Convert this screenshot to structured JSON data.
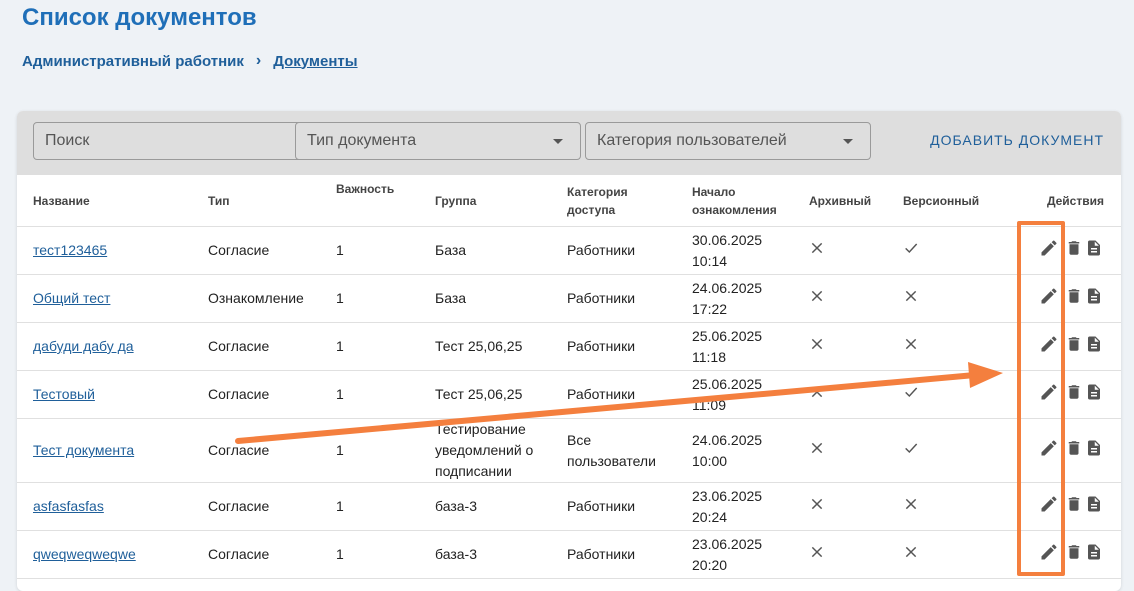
{
  "page": {
    "title": "Список документов",
    "breadcrumb": {
      "root": "Административный работник",
      "current": "Документы"
    }
  },
  "toolbar": {
    "search_placeholder": "Поиск",
    "doc_type_label": "Тип документа",
    "user_category_label": "Категория пользователей",
    "add_button": "ДОБАВИТЬ ДОКУМЕНТ"
  },
  "table": {
    "headers": {
      "name": "Название",
      "type": "Тип",
      "importance": "Важность",
      "group": "Группа",
      "access_category": "Категория доступа",
      "start": "Начало ознакомления",
      "archived": "Архивный",
      "versioned": "Версионный",
      "actions": "Действия"
    },
    "rows": [
      {
        "name": "тест123465",
        "type": "Согласие",
        "importance": "1",
        "group": "База",
        "access": "Работники",
        "start_date": "30.06.2025",
        "start_time": "10:14",
        "archived": false,
        "versioned": true
      },
      {
        "name": "Общий тест",
        "type": "Ознакомление",
        "importance": "1",
        "group": "База",
        "access": "Работники",
        "start_date": "24.06.2025",
        "start_time": "17:22",
        "archived": false,
        "versioned": false
      },
      {
        "name": "дабуди дабу да",
        "type": "Согласие",
        "importance": "1",
        "group": "Тест 25,06,25",
        "access": "Работники",
        "start_date": "25.06.2025",
        "start_time": "11:18",
        "archived": false,
        "versioned": false
      },
      {
        "name": "Тестовый",
        "type": "Согласие",
        "importance": "1",
        "group": "Тест 25,06,25",
        "access": "Работники",
        "start_date": "25.06.2025",
        "start_time": "11:09",
        "archived": false,
        "versioned": true
      },
      {
        "name": "Тест документа",
        "type": "Согласие",
        "importance": "1",
        "group": "Тестирование уведомлений о подписании",
        "access": "Все пользователи",
        "start_date": "24.06.2025",
        "start_time": "10:00",
        "archived": false,
        "versioned": true
      },
      {
        "name": "asfasfasfas",
        "type": "Согласие",
        "importance": "1",
        "group": "база-3",
        "access": "Работники",
        "start_date": "23.06.2025",
        "start_time": "20:24",
        "archived": false,
        "versioned": false
      },
      {
        "name": "qweqweqweqwe",
        "type": "Согласие",
        "importance": "1",
        "group": "база-3",
        "access": "Работники",
        "start_date": "23.06.2025",
        "start_time": "20:20",
        "archived": false,
        "versioned": false
      }
    ]
  },
  "icons": {
    "true": "check-icon",
    "false": "cross-icon",
    "actions": [
      "pencil-icon",
      "trash-icon",
      "document-icon"
    ]
  },
  "colors": {
    "accent": "#1f6fb8",
    "link": "#1f5f9a",
    "annotation": "#f47f3e",
    "toolbar_bg": "#dedede"
  }
}
